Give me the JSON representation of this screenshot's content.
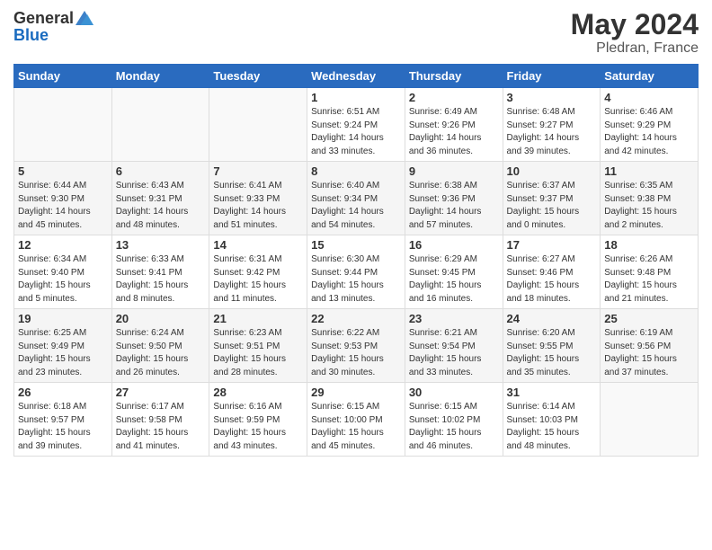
{
  "header": {
    "logo_general": "General",
    "logo_blue": "Blue",
    "month": "May 2024",
    "location": "Pledran, France"
  },
  "weekdays": [
    "Sunday",
    "Monday",
    "Tuesday",
    "Wednesday",
    "Thursday",
    "Friday",
    "Saturday"
  ],
  "weeks": [
    [
      {
        "day": "",
        "sunrise": "",
        "sunset": "",
        "daylight": ""
      },
      {
        "day": "",
        "sunrise": "",
        "sunset": "",
        "daylight": ""
      },
      {
        "day": "",
        "sunrise": "",
        "sunset": "",
        "daylight": ""
      },
      {
        "day": "1",
        "sunrise": "Sunrise: 6:51 AM",
        "sunset": "Sunset: 9:24 PM",
        "daylight": "Daylight: 14 hours and 33 minutes."
      },
      {
        "day": "2",
        "sunrise": "Sunrise: 6:49 AM",
        "sunset": "Sunset: 9:26 PM",
        "daylight": "Daylight: 14 hours and 36 minutes."
      },
      {
        "day": "3",
        "sunrise": "Sunrise: 6:48 AM",
        "sunset": "Sunset: 9:27 PM",
        "daylight": "Daylight: 14 hours and 39 minutes."
      },
      {
        "day": "4",
        "sunrise": "Sunrise: 6:46 AM",
        "sunset": "Sunset: 9:29 PM",
        "daylight": "Daylight: 14 hours and 42 minutes."
      }
    ],
    [
      {
        "day": "5",
        "sunrise": "Sunrise: 6:44 AM",
        "sunset": "Sunset: 9:30 PM",
        "daylight": "Daylight: 14 hours and 45 minutes."
      },
      {
        "day": "6",
        "sunrise": "Sunrise: 6:43 AM",
        "sunset": "Sunset: 9:31 PM",
        "daylight": "Daylight: 14 hours and 48 minutes."
      },
      {
        "day": "7",
        "sunrise": "Sunrise: 6:41 AM",
        "sunset": "Sunset: 9:33 PM",
        "daylight": "Daylight: 14 hours and 51 minutes."
      },
      {
        "day": "8",
        "sunrise": "Sunrise: 6:40 AM",
        "sunset": "Sunset: 9:34 PM",
        "daylight": "Daylight: 14 hours and 54 minutes."
      },
      {
        "day": "9",
        "sunrise": "Sunrise: 6:38 AM",
        "sunset": "Sunset: 9:36 PM",
        "daylight": "Daylight: 14 hours and 57 minutes."
      },
      {
        "day": "10",
        "sunrise": "Sunrise: 6:37 AM",
        "sunset": "Sunset: 9:37 PM",
        "daylight": "Daylight: 15 hours and 0 minutes."
      },
      {
        "day": "11",
        "sunrise": "Sunrise: 6:35 AM",
        "sunset": "Sunset: 9:38 PM",
        "daylight": "Daylight: 15 hours and 2 minutes."
      }
    ],
    [
      {
        "day": "12",
        "sunrise": "Sunrise: 6:34 AM",
        "sunset": "Sunset: 9:40 PM",
        "daylight": "Daylight: 15 hours and 5 minutes."
      },
      {
        "day": "13",
        "sunrise": "Sunrise: 6:33 AM",
        "sunset": "Sunset: 9:41 PM",
        "daylight": "Daylight: 15 hours and 8 minutes."
      },
      {
        "day": "14",
        "sunrise": "Sunrise: 6:31 AM",
        "sunset": "Sunset: 9:42 PM",
        "daylight": "Daylight: 15 hours and 11 minutes."
      },
      {
        "day": "15",
        "sunrise": "Sunrise: 6:30 AM",
        "sunset": "Sunset: 9:44 PM",
        "daylight": "Daylight: 15 hours and 13 minutes."
      },
      {
        "day": "16",
        "sunrise": "Sunrise: 6:29 AM",
        "sunset": "Sunset: 9:45 PM",
        "daylight": "Daylight: 15 hours and 16 minutes."
      },
      {
        "day": "17",
        "sunrise": "Sunrise: 6:27 AM",
        "sunset": "Sunset: 9:46 PM",
        "daylight": "Daylight: 15 hours and 18 minutes."
      },
      {
        "day": "18",
        "sunrise": "Sunrise: 6:26 AM",
        "sunset": "Sunset: 9:48 PM",
        "daylight": "Daylight: 15 hours and 21 minutes."
      }
    ],
    [
      {
        "day": "19",
        "sunrise": "Sunrise: 6:25 AM",
        "sunset": "Sunset: 9:49 PM",
        "daylight": "Daylight: 15 hours and 23 minutes."
      },
      {
        "day": "20",
        "sunrise": "Sunrise: 6:24 AM",
        "sunset": "Sunset: 9:50 PM",
        "daylight": "Daylight: 15 hours and 26 minutes."
      },
      {
        "day": "21",
        "sunrise": "Sunrise: 6:23 AM",
        "sunset": "Sunset: 9:51 PM",
        "daylight": "Daylight: 15 hours and 28 minutes."
      },
      {
        "day": "22",
        "sunrise": "Sunrise: 6:22 AM",
        "sunset": "Sunset: 9:53 PM",
        "daylight": "Daylight: 15 hours and 30 minutes."
      },
      {
        "day": "23",
        "sunrise": "Sunrise: 6:21 AM",
        "sunset": "Sunset: 9:54 PM",
        "daylight": "Daylight: 15 hours and 33 minutes."
      },
      {
        "day": "24",
        "sunrise": "Sunrise: 6:20 AM",
        "sunset": "Sunset: 9:55 PM",
        "daylight": "Daylight: 15 hours and 35 minutes."
      },
      {
        "day": "25",
        "sunrise": "Sunrise: 6:19 AM",
        "sunset": "Sunset: 9:56 PM",
        "daylight": "Daylight: 15 hours and 37 minutes."
      }
    ],
    [
      {
        "day": "26",
        "sunrise": "Sunrise: 6:18 AM",
        "sunset": "Sunset: 9:57 PM",
        "daylight": "Daylight: 15 hours and 39 minutes."
      },
      {
        "day": "27",
        "sunrise": "Sunrise: 6:17 AM",
        "sunset": "Sunset: 9:58 PM",
        "daylight": "Daylight: 15 hours and 41 minutes."
      },
      {
        "day": "28",
        "sunrise": "Sunrise: 6:16 AM",
        "sunset": "Sunset: 9:59 PM",
        "daylight": "Daylight: 15 hours and 43 minutes."
      },
      {
        "day": "29",
        "sunrise": "Sunrise: 6:15 AM",
        "sunset": "Sunset: 10:00 PM",
        "daylight": "Daylight: 15 hours and 45 minutes."
      },
      {
        "day": "30",
        "sunrise": "Sunrise: 6:15 AM",
        "sunset": "Sunset: 10:02 PM",
        "daylight": "Daylight: 15 hours and 46 minutes."
      },
      {
        "day": "31",
        "sunrise": "Sunrise: 6:14 AM",
        "sunset": "Sunset: 10:03 PM",
        "daylight": "Daylight: 15 hours and 48 minutes."
      },
      {
        "day": "",
        "sunrise": "",
        "sunset": "",
        "daylight": ""
      }
    ]
  ]
}
